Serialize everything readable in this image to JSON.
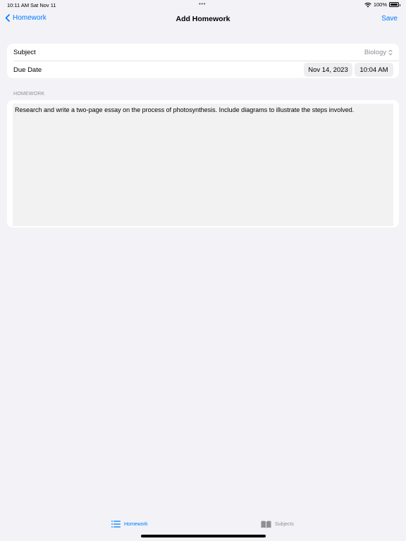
{
  "status_bar": {
    "time": "10:11 AM",
    "date": "Sat Nov 11",
    "dots": "•••",
    "battery": "100%"
  },
  "nav": {
    "back_label": "Homework",
    "title": "Add Homework",
    "save_label": "Save"
  },
  "form": {
    "subject_label": "Subject",
    "subject_value": "Biology",
    "due_label": "Due Date",
    "due_date": "Nov 14, 2023",
    "due_time": "10:04 AM"
  },
  "homework": {
    "section_header": "HOMEWORK",
    "text": "Research and write a two-page essay on the process of photosynthesis. Include diagrams to illustrate the steps involved."
  },
  "tabs": [
    {
      "label": "Homework",
      "icon": "list-icon",
      "selected": true
    },
    {
      "label": "Subjects",
      "icon": "book-icon",
      "selected": false
    }
  ],
  "colors": {
    "accent": "#007aff",
    "background": "#f2f2f7",
    "secondary_text": "#8e8e93"
  }
}
